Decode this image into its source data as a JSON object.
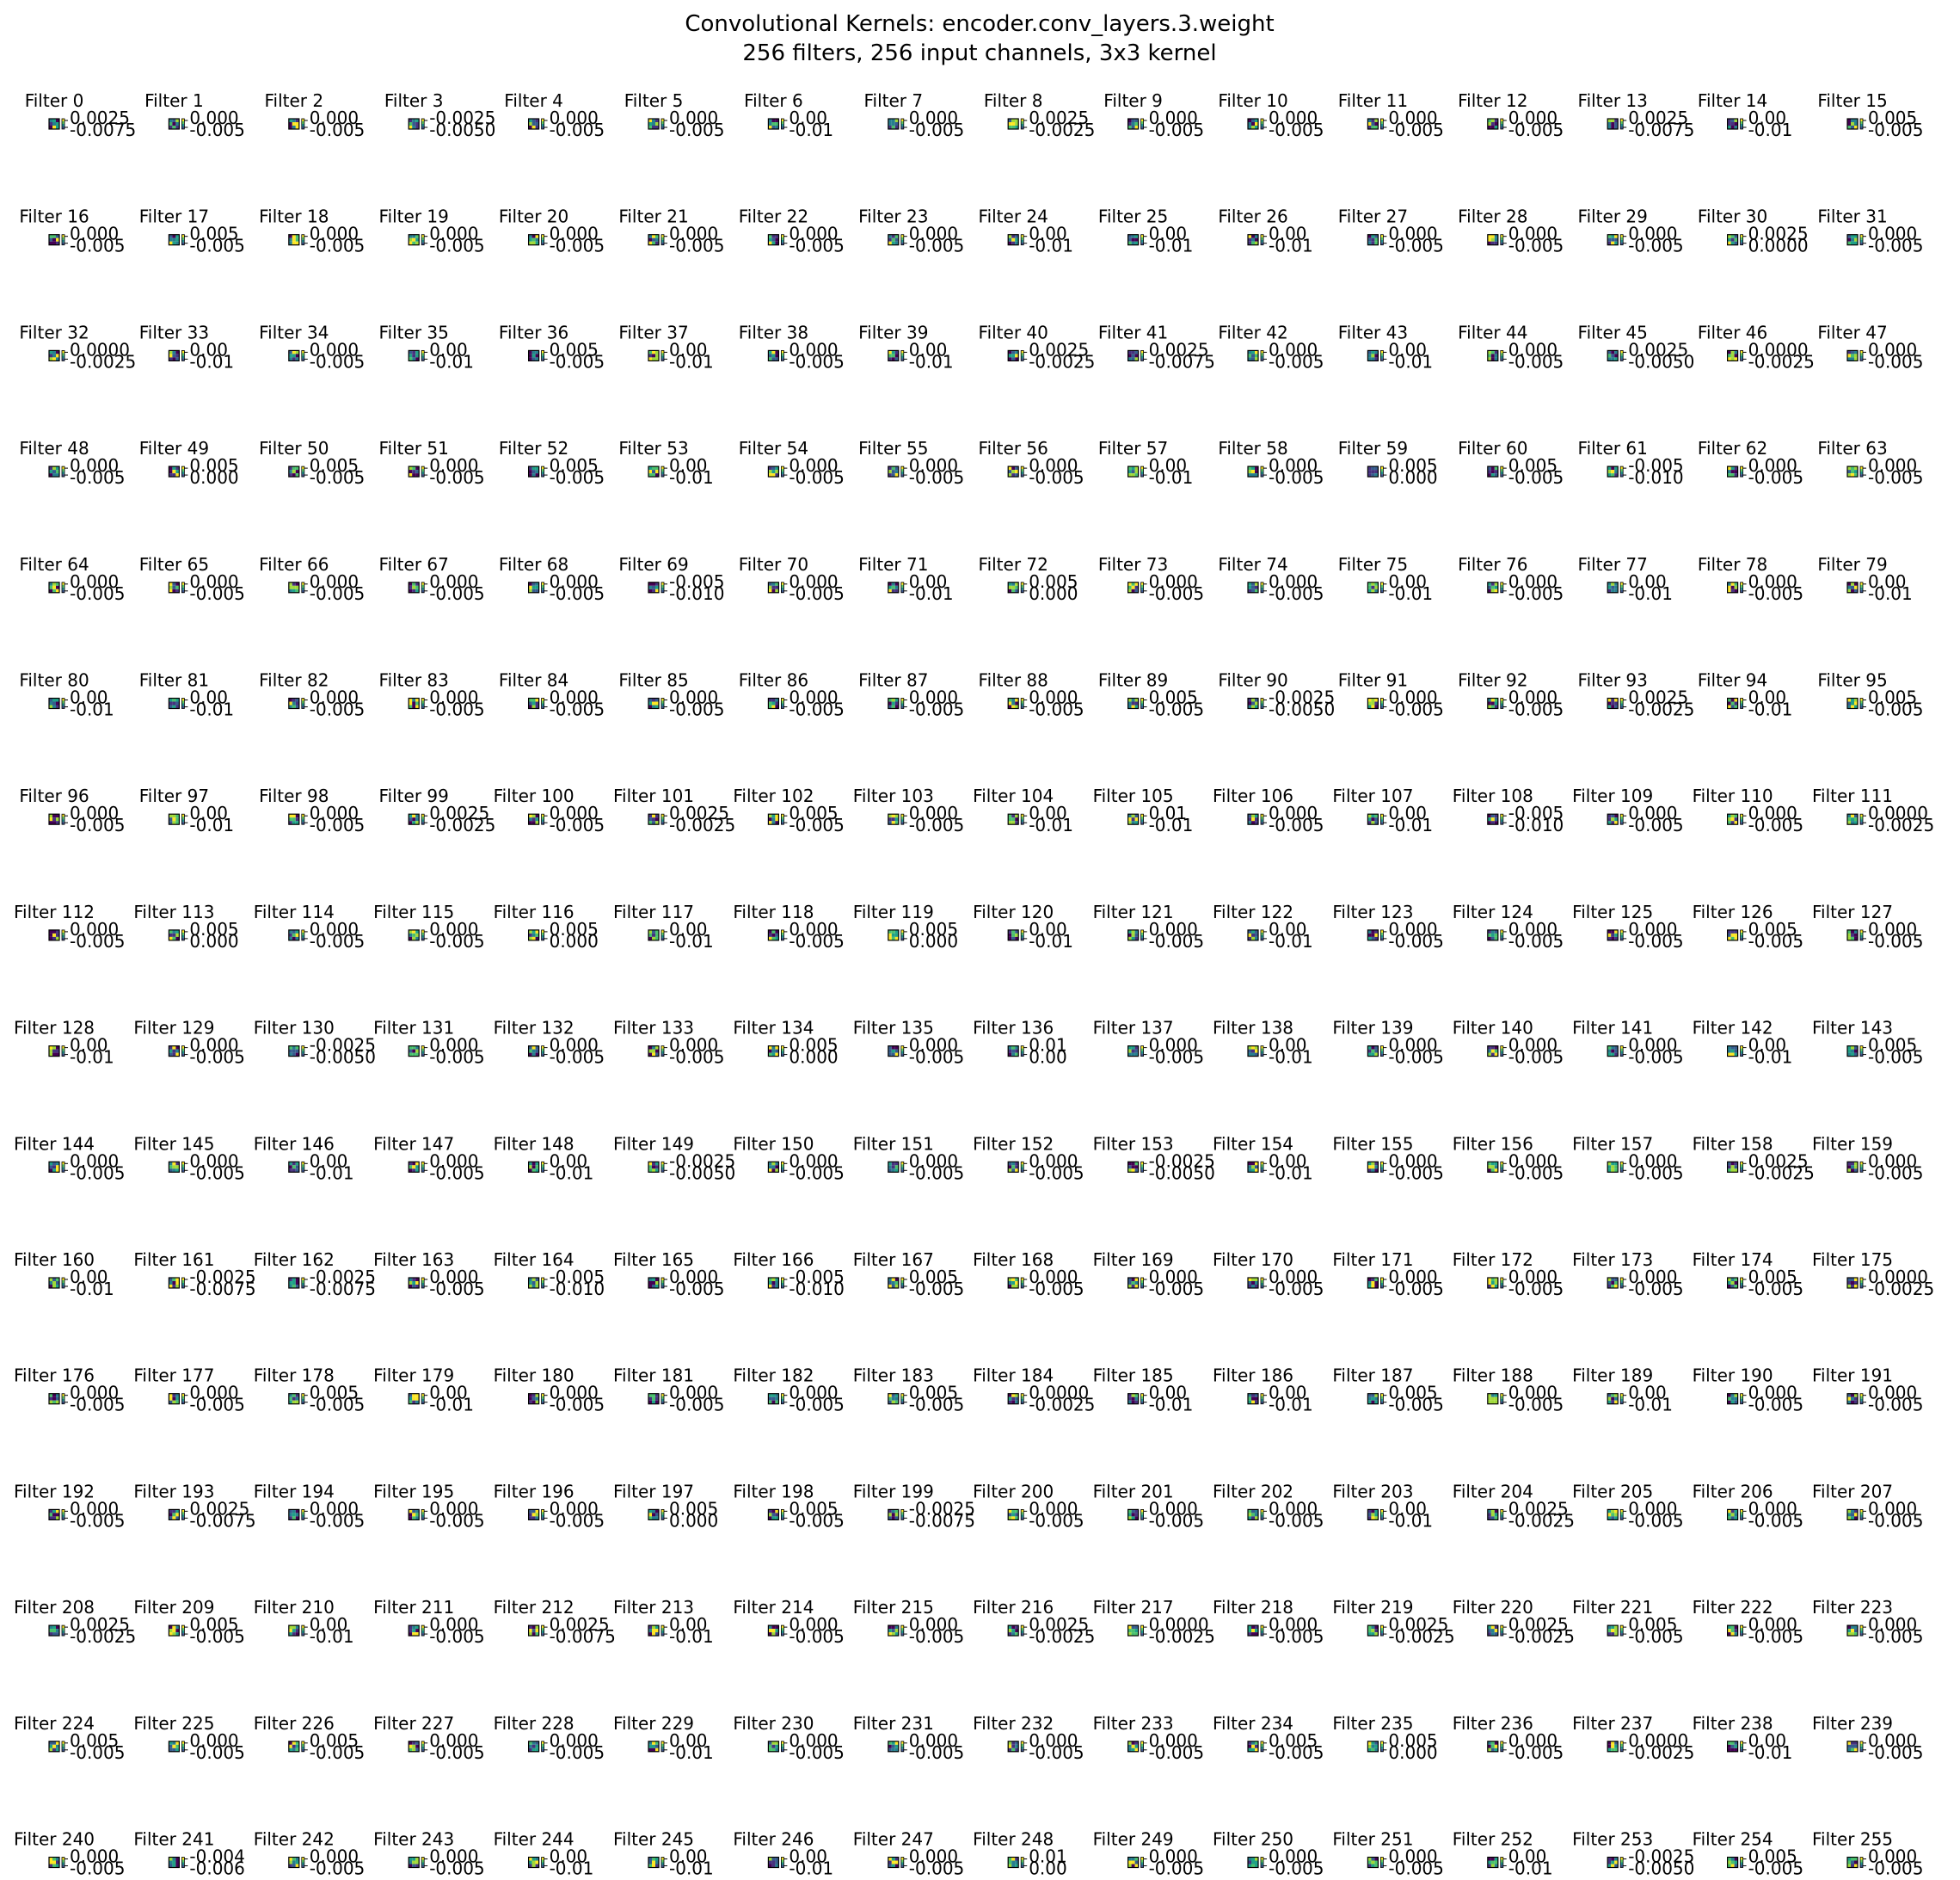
{
  "chart_data": {
    "type": "heatmap",
    "title": "Convolutional Kernels: encoder.conv_layers.3.weight",
    "subtitle": "256 filters, 256 input channels, 3x3 kernel",
    "colormap": "viridis",
    "grid": false,
    "filter_label_prefix": "Filter",
    "filter_count": 256,
    "columns": 16,
    "colorbar_labels": [
      [
        "0.0025",
        "-0.0075"
      ],
      [
        "0.000",
        "-0.005"
      ],
      [
        "0.000",
        "-0.005"
      ],
      [
        "-0.0025",
        "-0.0050"
      ],
      [
        "0.000",
        "-0.005"
      ],
      [
        "0.000",
        "-0.005"
      ],
      [
        "0.00",
        "-0.01"
      ],
      [
        "0.000",
        "-0.005"
      ],
      [
        "0.0025",
        "-0.0025"
      ],
      [
        "0.000",
        "-0.005"
      ],
      [
        "0.000",
        "-0.005"
      ],
      [
        "0.000",
        "-0.005"
      ],
      [
        "0.000",
        "-0.005"
      ],
      [
        "0.0025",
        "-0.0075"
      ],
      [
        "0.00",
        "-0.01"
      ],
      [
        "0.005",
        "-0.005"
      ],
      [
        "0.000",
        "-0.005"
      ],
      [
        "0.005",
        "-0.005"
      ],
      [
        "0.000",
        "-0.005"
      ],
      [
        "0.000",
        "-0.005"
      ],
      [
        "0.000",
        "-0.005"
      ],
      [
        "0.000",
        "-0.005"
      ],
      [
        "0.000",
        "-0.005"
      ],
      [
        "0.000",
        "-0.005"
      ],
      [
        "0.00",
        "-0.01"
      ],
      [
        "0.00",
        "-0.01"
      ],
      [
        "0.00",
        "-0.01"
      ],
      [
        "0.000",
        "-0.005"
      ],
      [
        "0.000",
        "-0.005"
      ],
      [
        "0.000",
        "-0.005"
      ],
      [
        "0.0025",
        "0.0000"
      ],
      [
        "0.000",
        "-0.005"
      ],
      [
        "0.0000",
        "-0.0025"
      ],
      [
        "0.00",
        "-0.01"
      ],
      [
        "0.000",
        "-0.005"
      ],
      [
        "0.00",
        "-0.01"
      ],
      [
        "0.005",
        "-0.005"
      ],
      [
        "0.00",
        "-0.01"
      ],
      [
        "0.000",
        "-0.005"
      ],
      [
        "0.00",
        "-0.01"
      ],
      [
        "0.0025",
        "-0.0025"
      ],
      [
        "0.0025",
        "-0.0075"
      ],
      [
        "0.000",
        "-0.005"
      ],
      [
        "0.00",
        "-0.01"
      ],
      [
        "0.000",
        "-0.005"
      ],
      [
        "0.0025",
        "-0.0050"
      ],
      [
        "0.0000",
        "-0.0025"
      ],
      [
        "0.000",
        "-0.005"
      ],
      [
        "0.000",
        "-0.005"
      ],
      [
        "0.005",
        "0.000"
      ],
      [
        "0.005",
        "-0.005"
      ],
      [
        "0.000",
        "-0.005"
      ],
      [
        "0.005",
        "-0.005"
      ],
      [
        "0.00",
        "-0.01"
      ],
      [
        "0.000",
        "-0.005"
      ],
      [
        "0.000",
        "-0.005"
      ],
      [
        "0.000",
        "-0.005"
      ],
      [
        "0.00",
        "-0.01"
      ],
      [
        "0.000",
        "-0.005"
      ],
      [
        "0.005",
        "0.000"
      ],
      [
        "0.005",
        "-0.005"
      ],
      [
        "-0.005",
        "-0.010"
      ],
      [
        "0.000",
        "-0.005"
      ],
      [
        "0.000",
        "-0.005"
      ],
      [
        "0.000",
        "-0.005"
      ],
      [
        "0.000",
        "-0.005"
      ],
      [
        "0.000",
        "-0.005"
      ],
      [
        "0.000",
        "-0.005"
      ],
      [
        "0.000",
        "-0.005"
      ],
      [
        "-0.005",
        "-0.010"
      ],
      [
        "0.000",
        "-0.005"
      ],
      [
        "0.00",
        "-0.01"
      ],
      [
        "0.005",
        "0.000"
      ],
      [
        "0.000",
        "-0.005"
      ],
      [
        "0.000",
        "-0.005"
      ],
      [
        "0.00",
        "-0.01"
      ],
      [
        "0.000",
        "-0.005"
      ],
      [
        "0.00",
        "-0.01"
      ],
      [
        "0.000",
        "-0.005"
      ],
      [
        "0.00",
        "-0.01"
      ],
      [
        "0.00",
        "-0.01"
      ],
      [
        "0.00",
        "-0.01"
      ],
      [
        "0.000",
        "-0.005"
      ],
      [
        "0.000",
        "-0.005"
      ],
      [
        "0.000",
        "-0.005"
      ],
      [
        "0.000",
        "-0.005"
      ],
      [
        "0.000",
        "-0.005"
      ],
      [
        "0.000",
        "-0.005"
      ],
      [
        "0.000",
        "-0.005"
      ],
      [
        "0.005",
        "-0.005"
      ],
      [
        "-0.0025",
        "-0.0050"
      ],
      [
        "0.000",
        "-0.005"
      ],
      [
        "0.000",
        "-0.005"
      ],
      [
        "0.0025",
        "-0.0025"
      ],
      [
        "0.00",
        "-0.01"
      ],
      [
        "0.005",
        "-0.005"
      ],
      [
        "0.000",
        "-0.005"
      ],
      [
        "0.00",
        "-0.01"
      ],
      [
        "0.000",
        "-0.005"
      ],
      [
        "0.0025",
        "-0.0025"
      ],
      [
        "0.000",
        "-0.005"
      ],
      [
        "0.0025",
        "-0.0025"
      ],
      [
        "0.005",
        "-0.005"
      ],
      [
        "0.000",
        "-0.005"
      ],
      [
        "0.00",
        "-0.01"
      ],
      [
        "0.01",
        "-0.01"
      ],
      [
        "0.000",
        "-0.005"
      ],
      [
        "0.00",
        "-0.01"
      ],
      [
        "-0.005",
        "-0.010"
      ],
      [
        "0.000",
        "-0.005"
      ],
      [
        "0.000",
        "-0.005"
      ],
      [
        "0.0000",
        "-0.0025"
      ],
      [
        "0.000",
        "-0.005"
      ],
      [
        "0.005",
        "0.000"
      ],
      [
        "0.000",
        "-0.005"
      ],
      [
        "0.000",
        "-0.005"
      ],
      [
        "0.005",
        "0.000"
      ],
      [
        "0.00",
        "-0.01"
      ],
      [
        "0.000",
        "-0.005"
      ],
      [
        "0.005",
        "0.000"
      ],
      [
        "0.00",
        "-0.01"
      ],
      [
        "0.000",
        "-0.005"
      ],
      [
        "0.00",
        "-0.01"
      ],
      [
        "0.000",
        "-0.005"
      ],
      [
        "0.000",
        "-0.005"
      ],
      [
        "0.000",
        "-0.005"
      ],
      [
        "0.005",
        "-0.005"
      ],
      [
        "0.000",
        "-0.005"
      ],
      [
        "0.00",
        "-0.01"
      ],
      [
        "0.000",
        "-0.005"
      ],
      [
        "-0.0025",
        "-0.0050"
      ],
      [
        "0.000",
        "-0.005"
      ],
      [
        "0.000",
        "-0.005"
      ],
      [
        "0.000",
        "-0.005"
      ],
      [
        "0.005",
        "0.000"
      ],
      [
        "0.000",
        "-0.005"
      ],
      [
        "0.01",
        "0.00"
      ],
      [
        "0.000",
        "-0.005"
      ],
      [
        "0.00",
        "-0.01"
      ],
      [
        "0.000",
        "-0.005"
      ],
      [
        "0.000",
        "-0.005"
      ],
      [
        "0.000",
        "-0.005"
      ],
      [
        "0.00",
        "-0.01"
      ],
      [
        "0.005",
        "-0.005"
      ],
      [
        "0.000",
        "-0.005"
      ],
      [
        "0.000",
        "-0.005"
      ],
      [
        "0.00",
        "-0.01"
      ],
      [
        "0.000",
        "-0.005"
      ],
      [
        "0.00",
        "-0.01"
      ],
      [
        "-0.0025",
        "-0.0050"
      ],
      [
        "0.000",
        "-0.005"
      ],
      [
        "0.000",
        "-0.005"
      ],
      [
        "0.000",
        "-0.005"
      ],
      [
        "-0.0025",
        "-0.0050"
      ],
      [
        "0.00",
        "-0.01"
      ],
      [
        "0.000",
        "-0.005"
      ],
      [
        "0.000",
        "-0.005"
      ],
      [
        "0.000",
        "-0.005"
      ],
      [
        "0.0025",
        "-0.0025"
      ],
      [
        "0.000",
        "-0.005"
      ],
      [
        "0.00",
        "-0.01"
      ],
      [
        "-0.0025",
        "-0.0075"
      ],
      [
        "-0.0025",
        "-0.0075"
      ],
      [
        "0.000",
        "-0.005"
      ],
      [
        "-0.005",
        "-0.010"
      ],
      [
        "0.000",
        "-0.005"
      ],
      [
        "-0.005",
        "-0.010"
      ],
      [
        "0.005",
        "-0.005"
      ],
      [
        "0.000",
        "-0.005"
      ],
      [
        "0.000",
        "-0.005"
      ],
      [
        "0.000",
        "-0.005"
      ],
      [
        "0.000",
        "-0.005"
      ],
      [
        "0.000",
        "-0.005"
      ],
      [
        "0.000",
        "-0.005"
      ],
      [
        "0.005",
        "-0.005"
      ],
      [
        "0.0000",
        "-0.0025"
      ],
      [
        "0.000",
        "-0.005"
      ],
      [
        "0.000",
        "-0.005"
      ],
      [
        "0.005",
        "-0.005"
      ],
      [
        "0.00",
        "-0.01"
      ],
      [
        "0.000",
        "-0.005"
      ],
      [
        "0.000",
        "-0.005"
      ],
      [
        "0.000",
        "-0.005"
      ],
      [
        "0.005",
        "-0.005"
      ],
      [
        "0.0000",
        "-0.0025"
      ],
      [
        "0.00",
        "-0.01"
      ],
      [
        "0.00",
        "-0.01"
      ],
      [
        "0.005",
        "-0.005"
      ],
      [
        "0.000",
        "-0.005"
      ],
      [
        "0.00",
        "-0.01"
      ],
      [
        "0.000",
        "-0.005"
      ],
      [
        "0.000",
        "-0.005"
      ],
      [
        "0.000",
        "-0.005"
      ],
      [
        "0.0025",
        "-0.0075"
      ],
      [
        "0.000",
        "-0.005"
      ],
      [
        "0.000",
        "-0.005"
      ],
      [
        "0.000",
        "-0.005"
      ],
      [
        "0.005",
        "0.000"
      ],
      [
        "0.005",
        "-0.005"
      ],
      [
        "-0.0025",
        "-0.0075"
      ],
      [
        "0.000",
        "-0.005"
      ],
      [
        "0.000",
        "-0.005"
      ],
      [
        "0.000",
        "-0.005"
      ],
      [
        "0.00",
        "-0.01"
      ],
      [
        "0.0025",
        "-0.0025"
      ],
      [
        "0.000",
        "-0.005"
      ],
      [
        "0.000",
        "-0.005"
      ],
      [
        "0.000",
        "-0.005"
      ],
      [
        "0.0025",
        "-0.0025"
      ],
      [
        "0.005",
        "-0.005"
      ],
      [
        "0.00",
        "-0.01"
      ],
      [
        "0.000",
        "-0.005"
      ],
      [
        "0.0025",
        "-0.0075"
      ],
      [
        "0.00",
        "-0.01"
      ],
      [
        "0.000",
        "-0.005"
      ],
      [
        "0.000",
        "-0.005"
      ],
      [
        "0.0025",
        "-0.0025"
      ],
      [
        "0.0000",
        "-0.0025"
      ],
      [
        "0.000",
        "-0.005"
      ],
      [
        "0.0025",
        "-0.0025"
      ],
      [
        "0.0025",
        "-0.0025"
      ],
      [
        "0.005",
        "-0.005"
      ],
      [
        "0.000",
        "-0.005"
      ],
      [
        "0.000",
        "-0.005"
      ],
      [
        "0.005",
        "-0.005"
      ],
      [
        "0.000",
        "-0.005"
      ],
      [
        "0.005",
        "-0.005"
      ],
      [
        "0.000",
        "-0.005"
      ],
      [
        "0.000",
        "-0.005"
      ],
      [
        "0.00",
        "-0.01"
      ],
      [
        "0.000",
        "-0.005"
      ],
      [
        "0.000",
        "-0.005"
      ],
      [
        "0.000",
        "-0.005"
      ],
      [
        "0.000",
        "-0.005"
      ],
      [
        "0.005",
        "-0.005"
      ],
      [
        "0.005",
        "0.000"
      ],
      [
        "0.000",
        "-0.005"
      ],
      [
        "0.0000",
        "-0.0025"
      ],
      [
        "0.00",
        "-0.01"
      ],
      [
        "0.000",
        "-0.005"
      ],
      [
        "0.000",
        "-0.005"
      ],
      [
        "-0.004",
        "-0.006"
      ],
      [
        "0.000",
        "-0.005"
      ],
      [
        "0.000",
        "-0.005"
      ],
      [
        "0.00",
        "-0.01"
      ],
      [
        "0.00",
        "-0.01"
      ],
      [
        "0.00",
        "-0.01"
      ],
      [
        "0.000",
        "-0.005"
      ],
      [
        "0.01",
        "0.00"
      ],
      [
        "0.000",
        "-0.005"
      ],
      [
        "0.000",
        "-0.005"
      ],
      [
        "0.000",
        "-0.005"
      ],
      [
        "0.00",
        "-0.01"
      ],
      [
        "-0.0025",
        "-0.0050"
      ],
      [
        "0.005",
        "-0.005"
      ],
      [
        "0.000",
        "-0.005"
      ]
    ]
  }
}
